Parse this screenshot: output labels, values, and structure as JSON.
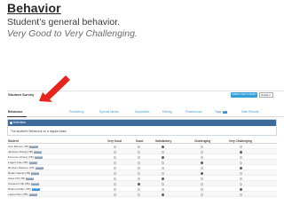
{
  "slide": {
    "title": "Behavior",
    "subtitle": "Student’s general behavior.",
    "description": "Very Good to Very Challenging."
  },
  "app": {
    "survey_title": "Student Survey",
    "action_button": "SUBMIT NEW SURVEY",
    "grade_select": "Grade 1",
    "tabs": [
      "Behaviour",
      "Proficiency",
      "Special Needs",
      "Separation",
      "Pairing",
      "Preferences",
      "Tags",
      "Date Results"
    ],
    "tag_badge": "37",
    "definition": {
      "heading": "Definition",
      "text": "The student’s Behaviour on a regular basis."
    },
    "columns": [
      "Student",
      "Very Good",
      "Good",
      "Satisfactory",
      "Challenging",
      "Very Challenging"
    ],
    "students": [
      {
        "name": "Alex Barnes (7B)",
        "badge": "Review",
        "badge_color": "#8fa2b5",
        "selected": 2
      },
      {
        "name": "Jackson Chang (7B)",
        "badge": "Review",
        "badge_color": "#8fa2b5",
        "selected": 4
      },
      {
        "name": "Florence Chang (7B)",
        "badge": "Review",
        "badge_color": "#8fa2b5",
        "selected": 2
      },
      {
        "name": "Logan Cole (7B)",
        "badge": "Review",
        "badge_color": "#8fa2b5",
        "selected": 3
      },
      {
        "name": "Reuben Dawson (7B)",
        "badge": "Review",
        "badge_color": "#8fa2b5",
        "selected": 4
      },
      {
        "name": "Ryder Garcia (7B)",
        "badge": "Review",
        "badge_color": "#8fa2b5",
        "selected": 3
      },
      {
        "name": "Isaac Hill (7B)",
        "badge": "Review",
        "badge_color": "#8fa2b5",
        "selected": 2
      },
      {
        "name": "Cameron Hill (7B)",
        "badge": "Review",
        "badge_color": "#8fa2b5",
        "selected": 1
      },
      {
        "name": "Brianna Miller (7B)",
        "badge": "Review",
        "badge_color": "#3d8fd6",
        "selected": 4
      },
      {
        "name": "Lauren Kim (7B)",
        "badge": "Review",
        "badge_color": "#8fa2b5",
        "selected": 2
      }
    ]
  },
  "colors": {
    "accent": "#2e9fd9",
    "definition_header": "#3c6a9c",
    "arrow": "#e8231b"
  }
}
